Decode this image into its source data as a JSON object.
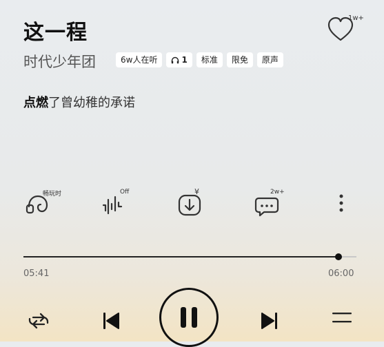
{
  "song": {
    "title": "这一程",
    "artist": "时代少年团",
    "favorite_count": "1w+"
  },
  "tags": [
    {
      "label": "6w人在听"
    },
    {
      "label": "1",
      "icon": "headphones-icon"
    },
    {
      "label": "标准"
    },
    {
      "label": "限免"
    },
    {
      "label": "原声"
    }
  ],
  "lyric": {
    "highlighted": "点燃",
    "rest": "了曾幼稚的承诺"
  },
  "tools": {
    "play_mode_label": "畅玩时",
    "effect_label": "Off",
    "download_badge": "¥",
    "comment_count": "2w+"
  },
  "playback": {
    "current_time": "05:41",
    "duration": "06:00",
    "progress_fraction": 0.947,
    "state": "playing"
  },
  "colors": {
    "accent": "#111111",
    "track": "#c8c8c8"
  }
}
